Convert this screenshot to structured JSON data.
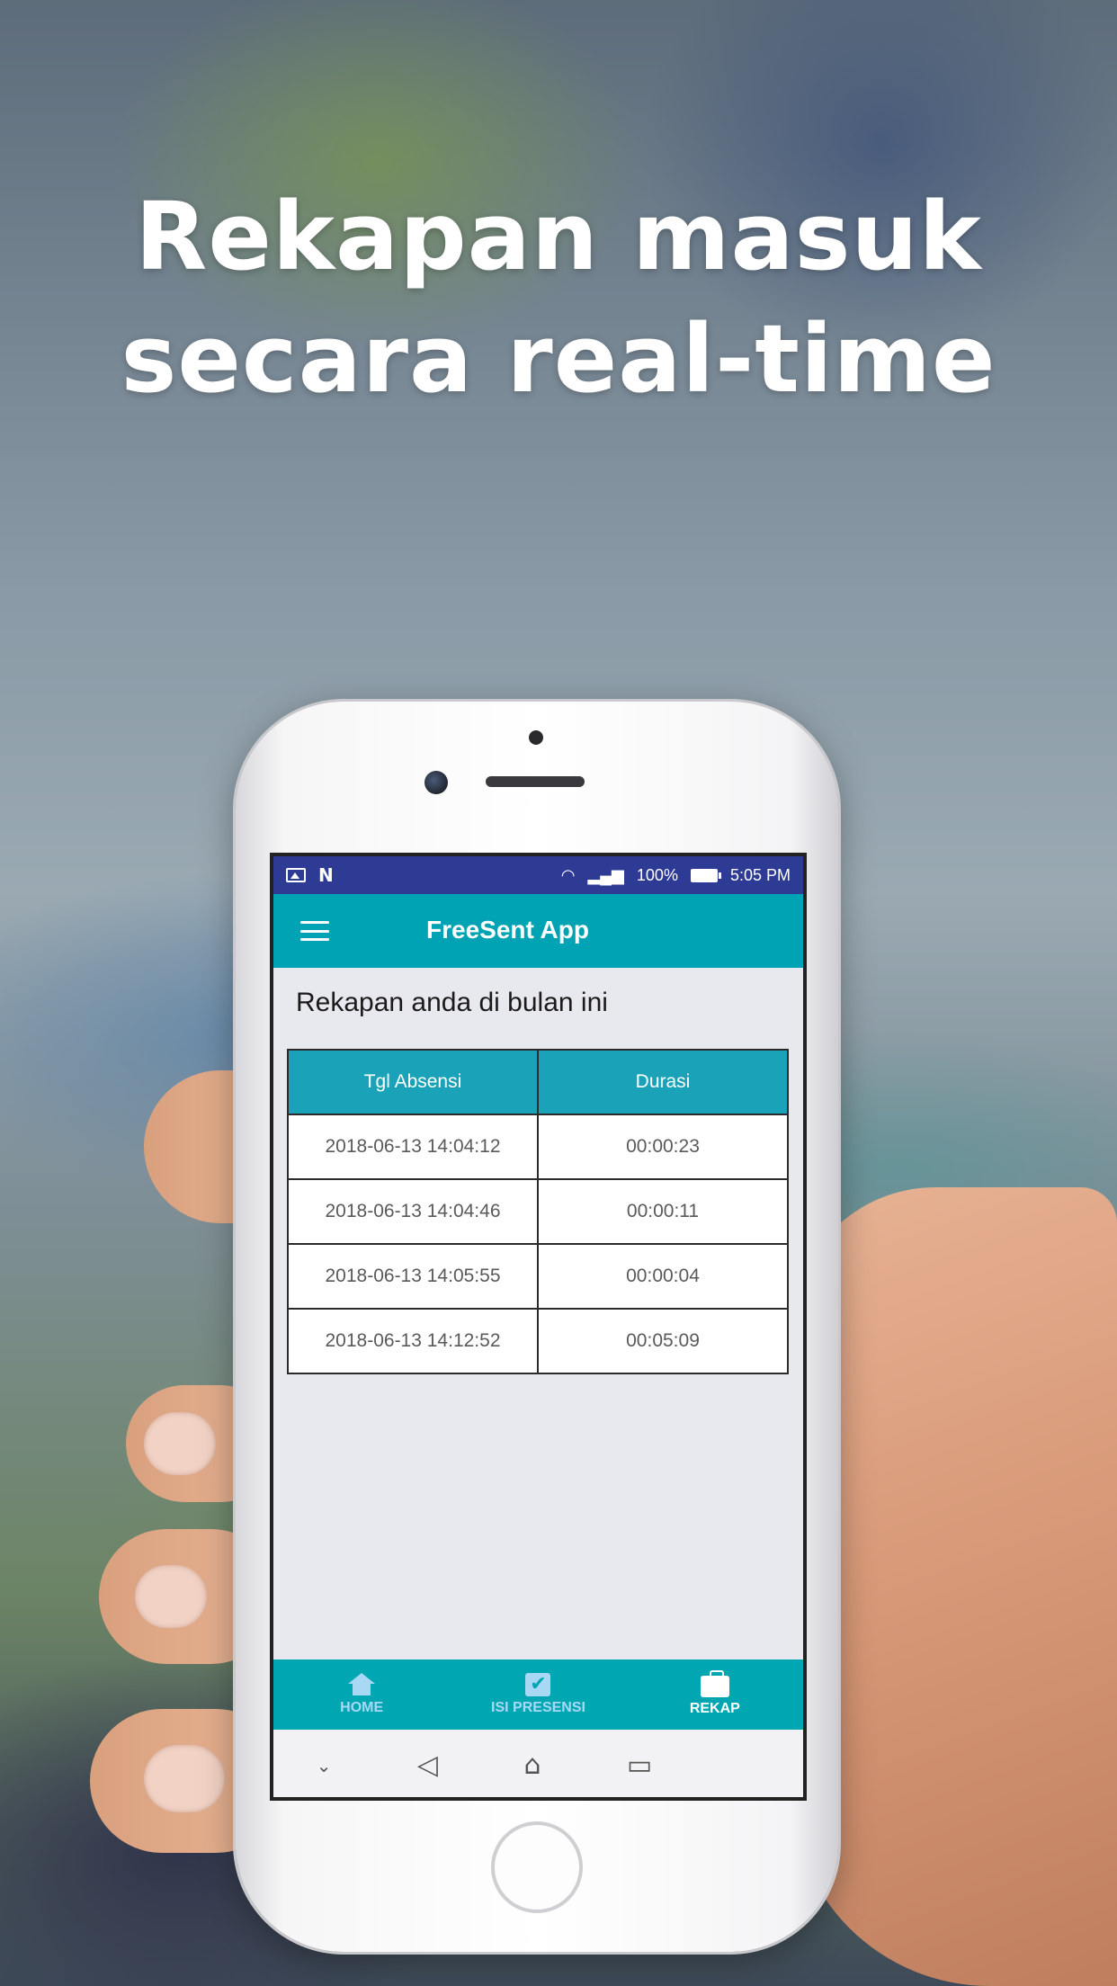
{
  "promo": {
    "line1": "Rekapan masuk",
    "line2": "secara real-time"
  },
  "statusbar": {
    "battery_pct": "100%",
    "time": "5:05 PM",
    "icons": [
      "image-icon",
      "n-notification-icon",
      "wifi-icon",
      "signal-icon",
      "battery-icon"
    ]
  },
  "appbar": {
    "title": "FreeSent App",
    "menu_icon": "hamburger-menu-icon"
  },
  "content": {
    "heading": "Rekapan anda di bulan ini",
    "table": {
      "headers": [
        "Tgl Absensi",
        "Durasi"
      ],
      "rows": [
        [
          "2018-06-13 14:04:12",
          "00:00:23"
        ],
        [
          "2018-06-13 14:04:46",
          "00:00:11"
        ],
        [
          "2018-06-13 14:05:55",
          "00:00:04"
        ],
        [
          "2018-06-13 14:12:52",
          "00:05:09"
        ]
      ]
    }
  },
  "bottomnav": {
    "items": [
      {
        "label": "HOME",
        "icon": "home-icon",
        "active": false
      },
      {
        "label": "ISI PRESENSI",
        "icon": "checkbox-icon",
        "active": false
      },
      {
        "label": "REKAP",
        "icon": "briefcase-icon",
        "active": true
      }
    ]
  },
  "sysnav": {
    "icons": [
      "keyboard-down-icon",
      "back-icon",
      "home-icon",
      "recents-icon"
    ]
  },
  "colors": {
    "statusbar": "#2e3b94",
    "appbar": "#00a3b3",
    "table_header": "#1aa3b8",
    "nav_inactive": "#a9d8f5",
    "nav_active": "#ffffff"
  }
}
